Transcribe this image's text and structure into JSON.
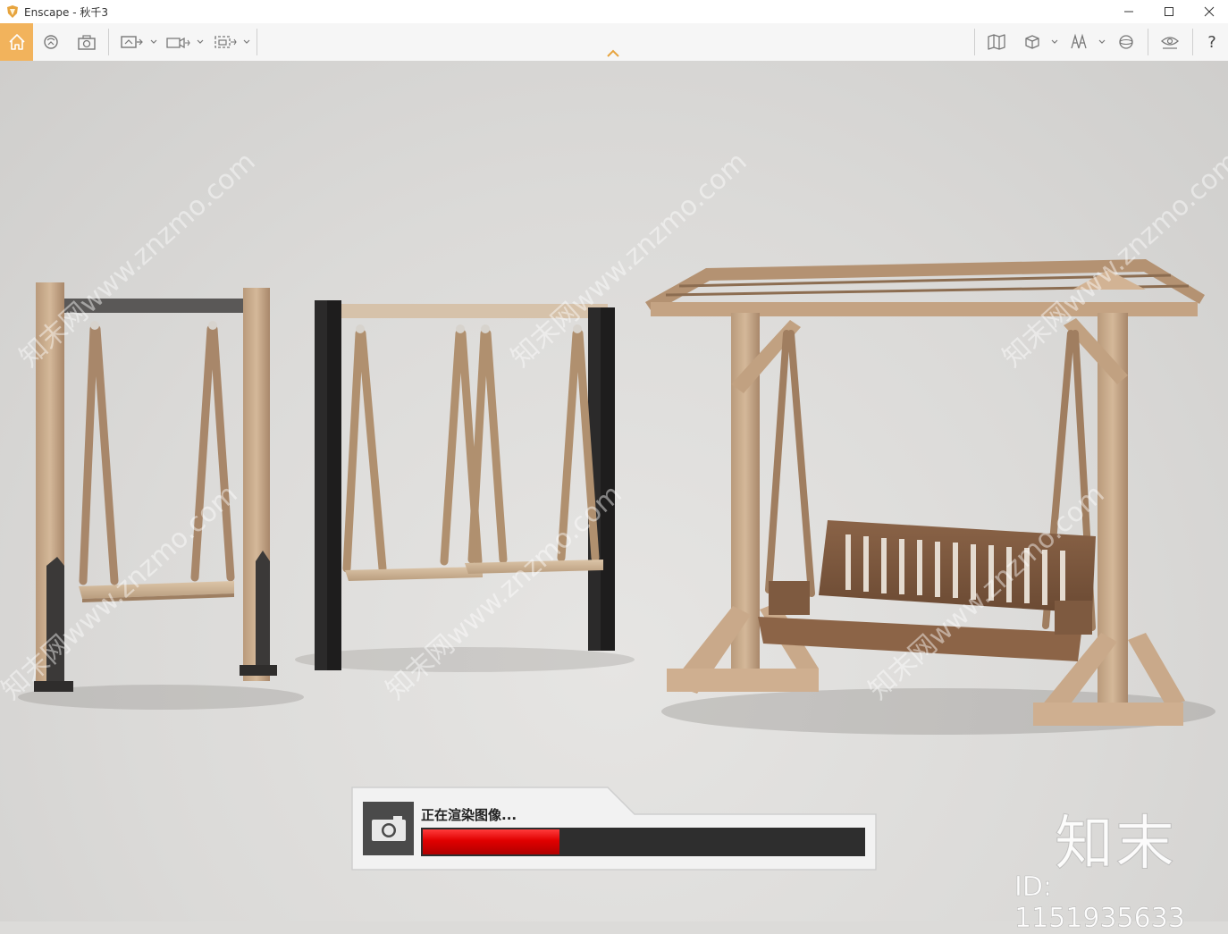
{
  "window": {
    "title": "Enscape - 秋千3",
    "controls": [
      "minimize",
      "maximize",
      "close"
    ]
  },
  "toolbar": {
    "left_icons": [
      "home-icon",
      "asset-library-icon",
      "screenshot-icon",
      "render-view-icon",
      "video-editor-icon",
      "batch-render-icon"
    ],
    "right_icons": [
      "map-icon",
      "cube-view-icon",
      "walk-mode-icon",
      "sphere-view-icon",
      "visual-settings-icon"
    ],
    "help_label": "?",
    "active_tool": "home-icon"
  },
  "render_status": {
    "label": "正在渲染图像...",
    "progress": 0.31,
    "progress_color": "#e00000"
  },
  "watermark": {
    "brand": "知末",
    "id_text": "ID: 1151935633",
    "site": "知末网www.znzmo.com"
  },
  "colors": {
    "home_button": "#f2b35c",
    "progress_fill": "#e00000",
    "accent_orange": "#e7a43e"
  }
}
